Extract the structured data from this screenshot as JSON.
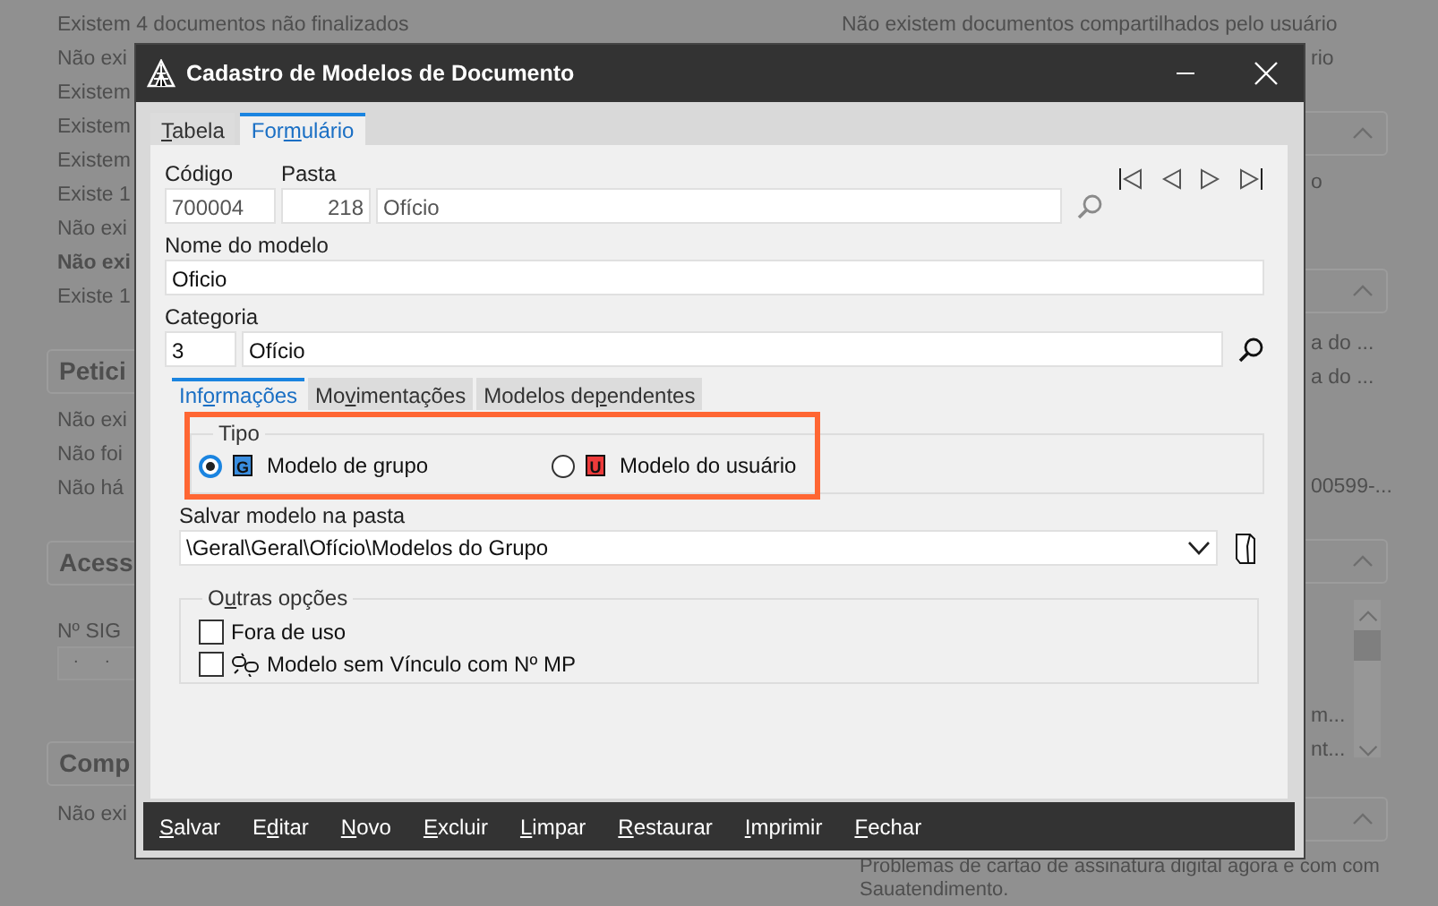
{
  "background": {
    "left_column": [
      {
        "kind": "text",
        "text": "Existem 4 documentos não finalizados"
      },
      {
        "kind": "text",
        "text": "Não exi"
      },
      {
        "kind": "text",
        "text": "Existem"
      },
      {
        "kind": "text",
        "text": "Existem"
      },
      {
        "kind": "text",
        "text": "Existem"
      },
      {
        "kind": "text",
        "text": "Existe 1"
      },
      {
        "kind": "text",
        "text": "Não exi"
      },
      {
        "kind": "bold",
        "text": "Não exi"
      },
      {
        "kind": "text",
        "text": "Existe 1"
      },
      {
        "kind": "card",
        "text": "Petici"
      },
      {
        "kind": "text",
        "text": "Não exi"
      },
      {
        "kind": "text",
        "text": "Não foi"
      },
      {
        "kind": "text",
        "text": "Não há"
      },
      {
        "kind": "card",
        "text": "Acess"
      },
      {
        "kind": "label",
        "text": "Nº SIG"
      },
      {
        "kind": "field",
        "text": ". ."
      },
      {
        "kind": "card",
        "text": "Comp"
      },
      {
        "kind": "text",
        "text": "Não exi"
      }
    ],
    "right_column": [
      {
        "kind": "text",
        "text": "Não existem documentos compartilhados pelo usuário"
      },
      {
        "kind": "peek",
        "text": "rio"
      },
      {
        "kind": "card"
      },
      {
        "kind": "peek",
        "text": "o"
      },
      {
        "kind": "card"
      },
      {
        "kind": "peek",
        "text": "a do ..."
      },
      {
        "kind": "peek",
        "text": "a do ..."
      },
      {
        "kind": "peek",
        "text": "00599-..."
      },
      {
        "kind": "card"
      },
      {
        "kind": "list",
        "items": [
          "m...",
          "nt..."
        ]
      },
      {
        "kind": "card"
      },
      {
        "kind": "note",
        "text": "Problemas de cartao de assinatura digital agora e com com Sauatendimento."
      }
    ]
  },
  "window": {
    "title": "Cadastro de Modelos de Documento"
  },
  "tabs": [
    {
      "label": {
        "key": "T",
        "after": "abela"
      },
      "selected": false
    },
    {
      "label": {
        "before": "For",
        "key": "m",
        "after": "ulário"
      },
      "selected": true
    }
  ],
  "form": {
    "codigo": {
      "label": "Código",
      "value": "700004"
    },
    "pasta": {
      "label": "Pasta",
      "number": "218",
      "name": "Ofício"
    },
    "nome": {
      "label": "Nome do modelo",
      "value": "Oficio"
    },
    "categoria": {
      "label": "Categoria",
      "code": "3",
      "name": "Ofício"
    }
  },
  "subtabs": [
    {
      "label": {
        "before": "Inf",
        "key": "o",
        "after": "rmações"
      },
      "selected": true
    },
    {
      "label": {
        "before": "Mo",
        "key": "v",
        "after": "imentações"
      },
      "selected": false
    },
    {
      "label": {
        "before": "Modelos de",
        "key": "p",
        "after": "endentes"
      },
      "selected": false
    }
  ],
  "tipo": {
    "legend": "Tipo",
    "highlighted": true,
    "options": [
      {
        "badge": "G",
        "color": "#3a8ee0",
        "label": "Modelo de grupo",
        "selected": true
      },
      {
        "badge": "U",
        "color": "#ee3b3b",
        "label": "Modelo do usuário",
        "selected": false
      }
    ]
  },
  "pasta_destino": {
    "label": "Salvar modelo na pasta",
    "value": "\\Geral\\Geral\\Ofício\\Modelos do Grupo"
  },
  "outras": {
    "legend": {
      "before": "O",
      "key": "u",
      "after": "tras opções"
    },
    "options": [
      {
        "kind": "plain",
        "label": "Fora de uso",
        "checked": false
      },
      {
        "kind": "link",
        "label": "Modelo sem Vínculo com Nº MP",
        "checked": false
      }
    ]
  },
  "toolbar": [
    {
      "key": "S",
      "after": "alvar"
    },
    {
      "before": "E",
      "key": "d",
      "after": "itar"
    },
    {
      "key": "N",
      "after": "ovo"
    },
    {
      "key": "E",
      "after": "xcluir"
    },
    {
      "key": "L",
      "after": "impar"
    },
    {
      "key": "R",
      "after": "estaurar"
    },
    {
      "key": "I",
      "after": "mprimir"
    },
    {
      "key": "F",
      "after": "echar"
    }
  ]
}
